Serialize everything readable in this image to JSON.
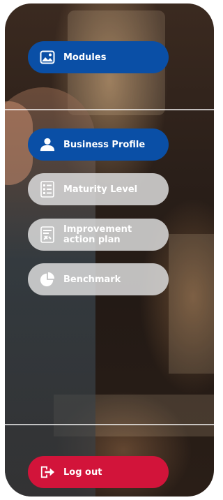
{
  "colors": {
    "active": "#0a4fa6",
    "inactive": "#d9d9d9",
    "logout": "#d2143a",
    "text": "#ffffff"
  },
  "menu": {
    "modules": {
      "label": "Modules",
      "icon": "image-icon"
    },
    "business_profile": {
      "label": "Business Profile",
      "icon": "user-icon"
    },
    "maturity_level": {
      "label": "Maturity Level",
      "icon": "checklist-icon"
    },
    "improvement_plan": {
      "label": "Improvement action plan",
      "icon": "plan-document-icon"
    },
    "benchmark": {
      "label": "Benchmark",
      "icon": "pie-chart-icon"
    },
    "logout": {
      "label": "Log out",
      "icon": "logout-icon"
    }
  }
}
